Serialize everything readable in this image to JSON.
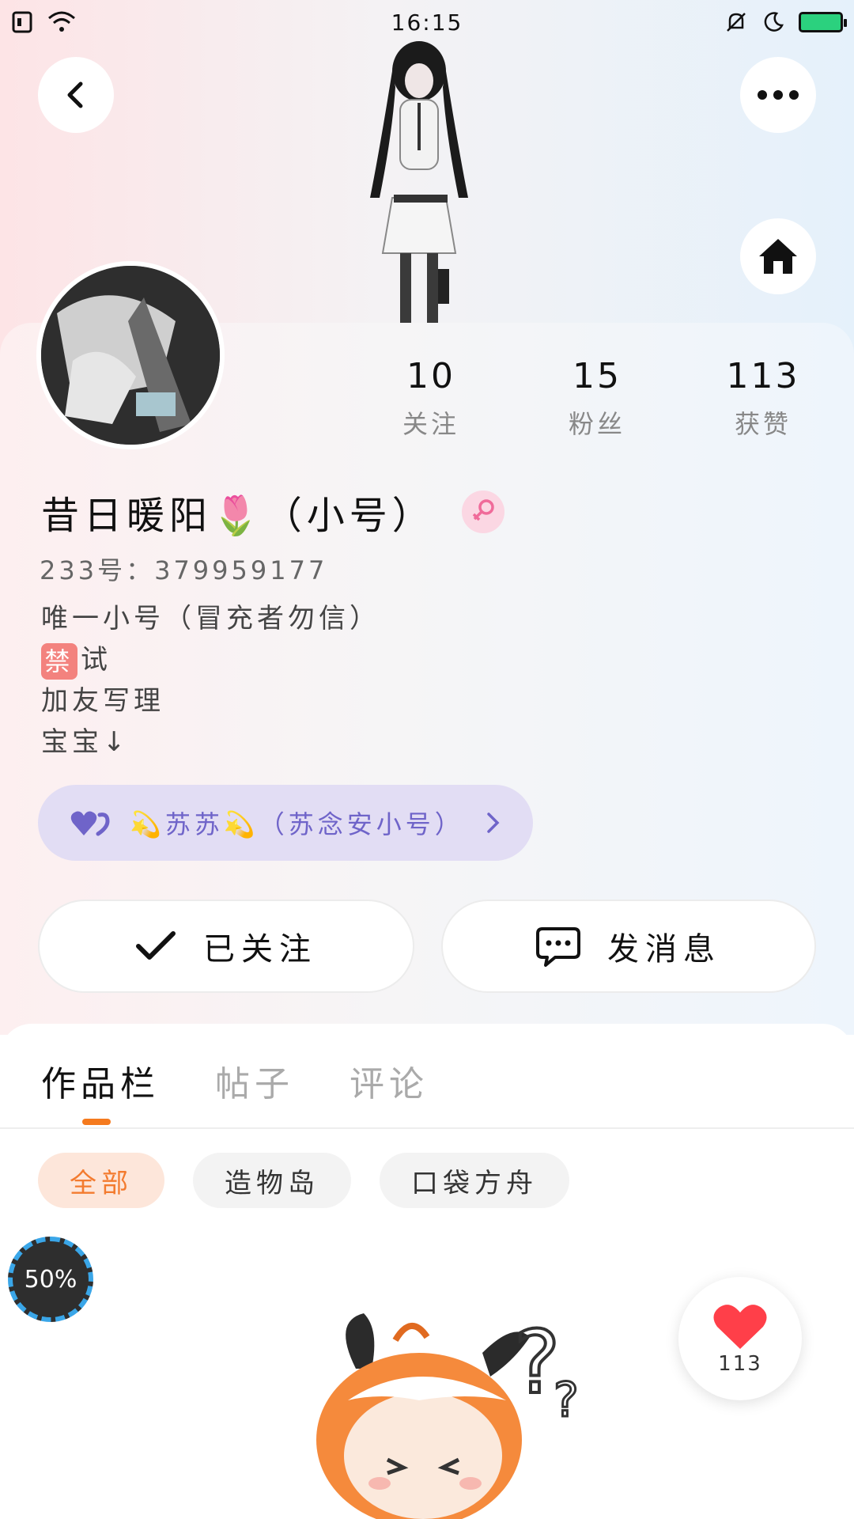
{
  "status_bar": {
    "time": "16:15"
  },
  "profile": {
    "username": "昔日暖阳🌷（小号）",
    "uid": "233号：379959177",
    "bio_lines": [
      "唯一小号（冒充者勿信）",
      "试",
      "加友写理",
      "宝宝↓"
    ],
    "ban_badge": "禁",
    "stats": [
      {
        "value": "10",
        "label": "关注"
      },
      {
        "value": "15",
        "label": "粉丝"
      },
      {
        "value": "113",
        "label": "获赞"
      }
    ],
    "cp_link": "💫苏苏💫（苏念安小号）"
  },
  "actions": {
    "following_label": "已关注",
    "message_label": "发消息"
  },
  "tabs": [
    "作品栏",
    "帖子",
    "评论"
  ],
  "chips": [
    "全部",
    "造物岛",
    "口袋方舟"
  ],
  "overlay": {
    "speed_label": "50%",
    "like_count": "113"
  },
  "colors": {
    "accent": "#f57a1e",
    "cp_text": "#6f64c9",
    "cp_bg": "#e2ddf4",
    "like": "#ff3f49"
  }
}
